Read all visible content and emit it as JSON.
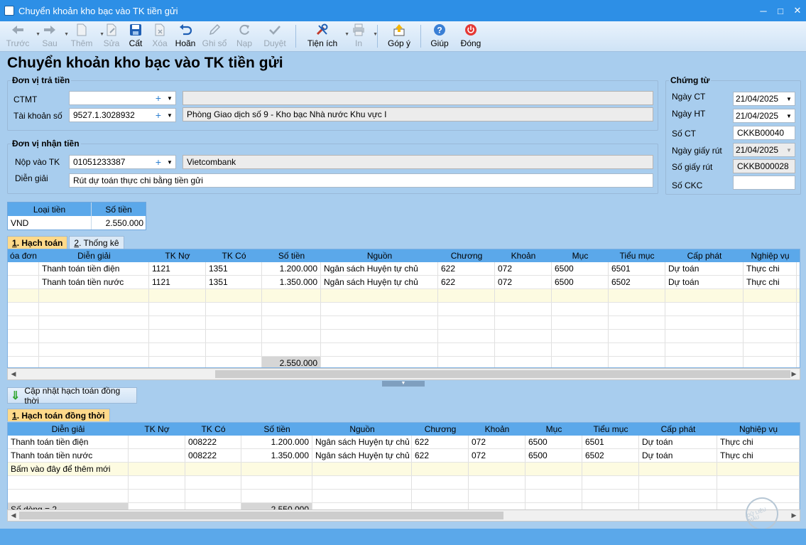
{
  "window": {
    "title": "Chuyển khoản kho bạc vào TK tiền gửi"
  },
  "toolbar": [
    {
      "label": "Trước",
      "icon": "arrow-left-icon",
      "enabled": false,
      "dropdown": true
    },
    {
      "label": "Sau",
      "icon": "arrow-right-icon",
      "enabled": false,
      "dropdown": true
    },
    {
      "label": "Thêm",
      "icon": "new-document-icon",
      "enabled": false,
      "dropdown": true
    },
    {
      "label": "Sửa",
      "icon": "edit-document-icon",
      "enabled": false,
      "dropdown": false
    },
    {
      "label": "Cất",
      "icon": "save-icon",
      "enabled": true,
      "dropdown": false
    },
    {
      "label": "Xóa",
      "icon": "delete-document-icon",
      "enabled": false,
      "dropdown": false
    },
    {
      "label": "Hoãn",
      "icon": "undo-icon",
      "enabled": true,
      "dropdown": false
    },
    {
      "label": "Ghi sổ",
      "icon": "pencil-icon",
      "enabled": false,
      "dropdown": false
    },
    {
      "label": "Nạp",
      "icon": "refresh-icon",
      "enabled": false,
      "dropdown": false
    },
    {
      "label": "Duyệt",
      "icon": "check-icon",
      "enabled": false,
      "dropdown": false
    },
    {
      "label": "Tiện ích",
      "icon": "tools-icon",
      "enabled": true,
      "dropdown": true
    },
    {
      "label": "In",
      "icon": "printer-icon",
      "enabled": false,
      "dropdown": true
    },
    {
      "label": "Góp ý",
      "icon": "feedback-icon",
      "enabled": true,
      "dropdown": false
    },
    {
      "label": "Giúp",
      "icon": "help-icon",
      "enabled": true,
      "dropdown": false
    },
    {
      "label": "Đóng",
      "icon": "power-icon",
      "enabled": true,
      "dropdown": false
    }
  ],
  "page_title": "Chuyển khoản kho bạc vào TK tiền gửi",
  "payer": {
    "legend": "Đơn vị trả tiền",
    "ctmt_label": "CTMT",
    "ctmt_value": "",
    "ctmt_name": "",
    "account_label": "Tài khoản số",
    "account_value": "9527.1.3028932",
    "account_name": "Phòng Giao dịch số 9 - Kho bạc Nhà nước Khu vực I"
  },
  "payee": {
    "legend": "Đơn vị nhận tiền",
    "account_label": "Nộp vào TK",
    "account_value": "01051233387",
    "bank_name": "Vietcombank",
    "desc_label": "Diễn giải",
    "desc_value": "Rút dự toán thực chi bằng tiền gửi"
  },
  "voucher": {
    "legend": "Chứng từ",
    "date_label": "Ngày CT",
    "date_value": "21/04/2025",
    "post_date_label": "Ngày HT",
    "post_date_value": "21/04/2025",
    "number_label": "Số CT",
    "number_value": "CKKB00040",
    "withdraw_date_label": "Ngày giấy rút",
    "withdraw_date_value": "21/04/2025",
    "withdraw_no_label": "Số giấy rút",
    "withdraw_no_value": "CKKB000028",
    "ckc_label": "Số CKC",
    "ckc_value": ""
  },
  "currency_table": {
    "headers": [
      "Loại tiền",
      "Số tiền"
    ],
    "rows": [
      [
        "VND",
        "2.550.000"
      ]
    ]
  },
  "tabs1": [
    {
      "num": "1",
      "label": ". Hạch toán",
      "active": true
    },
    {
      "num": "2",
      "label": ". Thống kê",
      "active": false
    }
  ],
  "grid1": {
    "headers": [
      "óa đơn",
      "Diễn giải",
      "TK Nợ",
      "TK Có",
      "Số tiền",
      "Nguồn",
      "Chương",
      "Khoản",
      "Mục",
      "Tiểu mục",
      "Cấp phát",
      "Nghiệp vụ"
    ],
    "rows": [
      [
        "",
        "Thanh toán tiền điện",
        "1121",
        "1351",
        "1.200.000",
        "Ngân sách Huyện tự chủ",
        "622",
        "072",
        "6500",
        "6501",
        "Dự toán",
        "Thực chi"
      ],
      [
        "",
        "Thanh toán tiền nước",
        "1121",
        "1351",
        "1.350.000",
        "Ngân sách Huyện tự chủ",
        "622",
        "072",
        "6500",
        "6502",
        "Dự toán",
        "Thực chi"
      ]
    ],
    "total": "2.550.000"
  },
  "update_button": "Cập nhật hạch toán đồng thời",
  "tabs2": [
    {
      "num": "1",
      "label": ". Hạch toán đồng thời",
      "active": true
    }
  ],
  "grid2": {
    "headers": [
      "Diễn giải",
      "TK Nợ",
      "TK Có",
      "Số tiền",
      "Nguồn",
      "Chương",
      "Khoản",
      "Mục",
      "Tiểu mục",
      "Cấp phát",
      "Nghiệp vụ"
    ],
    "rows": [
      [
        "Thanh toán tiền điện",
        "",
        "008222",
        "1.200.000",
        "Ngân sách Huyện tự chủ",
        "622",
        "072",
        "6500",
        "6501",
        "Dự toán",
        "Thực chi"
      ],
      [
        "Thanh toán tiền nước",
        "",
        "008222",
        "1.350.000",
        "Ngân sách Huyện tự chủ",
        "622",
        "072",
        "6500",
        "6502",
        "Dự toán",
        "Thực chi"
      ]
    ],
    "new_row_hint": "Bấm vào đây để thêm mới",
    "row_count": "Số dòng = 2",
    "total": "2.550.000"
  }
}
